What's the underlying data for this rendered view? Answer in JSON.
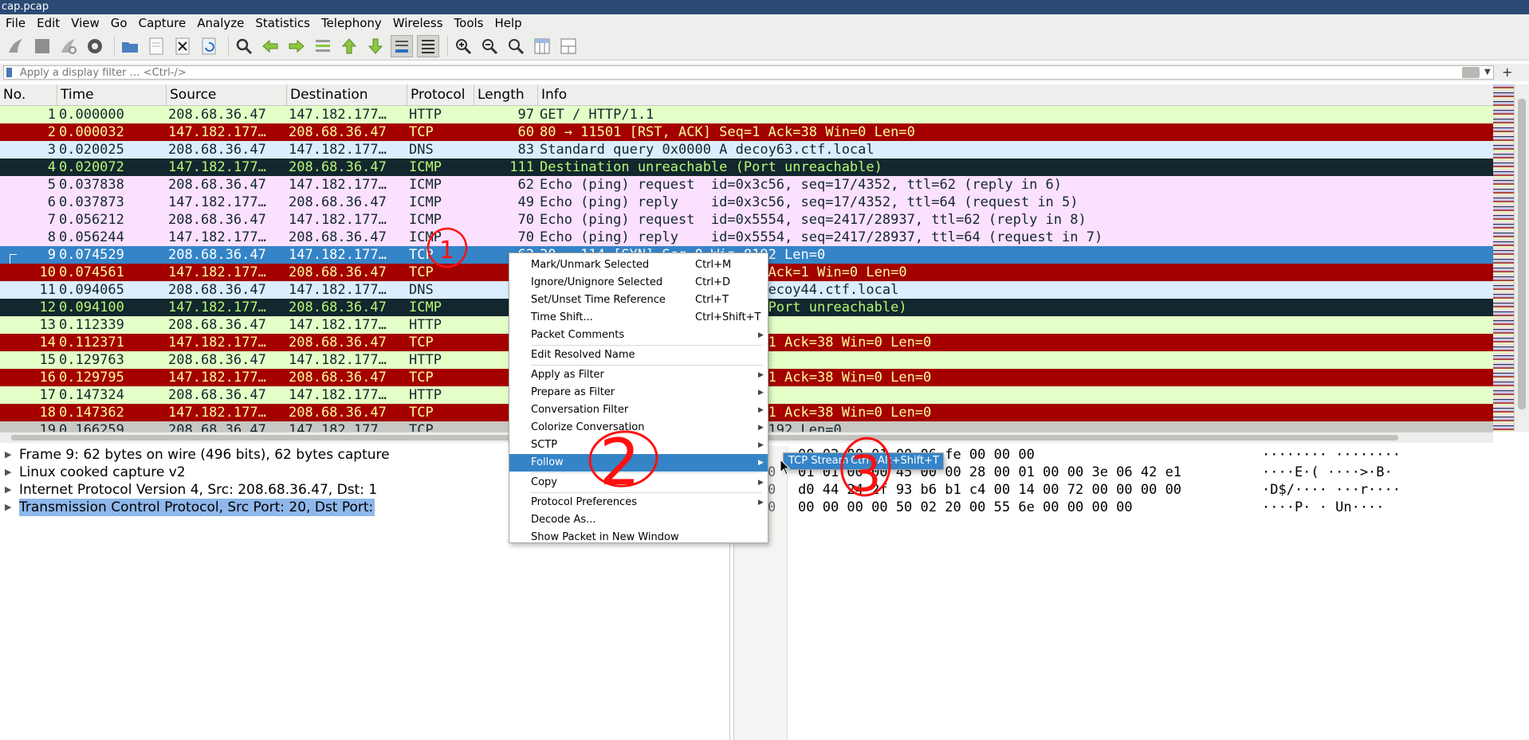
{
  "window": {
    "title": "cap.pcap"
  },
  "menubar": [
    "File",
    "Edit",
    "View",
    "Go",
    "Capture",
    "Analyze",
    "Statistics",
    "Telephony",
    "Wireless",
    "Tools",
    "Help"
  ],
  "toolbar": {
    "icons": [
      "shark-fin-start-icon",
      "stop-square-icon",
      "shark-fin-restart-icon",
      "capture-options-gear-icon",
      "open-folder-icon",
      "save-file-icon",
      "close-file-icon",
      "reload-icon",
      "find-magnifier-icon",
      "go-back-arrow-icon",
      "go-forward-arrow-icon",
      "go-to-packet-icon",
      "go-first-icon",
      "go-last-icon",
      "autoscroll-icon",
      "colorize-icon",
      "zoom-in-icon",
      "zoom-out-icon",
      "zoom-normal-icon",
      "resize-columns-icon",
      "layout-icon"
    ]
  },
  "filter": {
    "placeholder": "Apply a display filter … <Ctrl-/>"
  },
  "columns": [
    "No.",
    "Time",
    "Source",
    "Destination",
    "Protocol",
    "Length",
    "Info"
  ],
  "colors": {
    "http_bg": "#e4ffc7",
    "http_fg": "#12272e",
    "tcp_err_bg": "#a40000",
    "tcp_err_fg": "#fffc9c",
    "dns_bg": "#daeeff",
    "dns_fg": "#12272e",
    "icmp_err_bg": "#12272e",
    "icmp_err_fg": "#b7f774",
    "icmp_bg": "#fce0ff",
    "icmp_fg": "#12272e",
    "selected_bg": "#3584c7",
    "selected_fg": "#ffffff",
    "annotation_red": "#ff1010"
  },
  "packets": [
    {
      "no": "1",
      "time": "0.000000",
      "src": "208.68.36.47",
      "dst": "147.182.177…",
      "proto": "HTTP",
      "len": "97",
      "info": "GET / HTTP/1.1",
      "cls": "http"
    },
    {
      "no": "2",
      "time": "0.000032",
      "src": "147.182.177…",
      "dst": "208.68.36.47",
      "proto": "TCP",
      "len": "60",
      "info": "80 → 11501 [RST, ACK] Seq=1 Ack=38 Win=0 Len=0",
      "cls": "tcp_err"
    },
    {
      "no": "3",
      "time": "0.020025",
      "src": "208.68.36.47",
      "dst": "147.182.177…",
      "proto": "DNS",
      "len": "83",
      "info": "Standard query 0x0000 A decoy63.ctf.local",
      "cls": "dns"
    },
    {
      "no": "4",
      "time": "0.020072",
      "src": "147.182.177…",
      "dst": "208.68.36.47",
      "proto": "ICMP",
      "len": "111",
      "info": "Destination unreachable (Port unreachable)",
      "cls": "icmp_err"
    },
    {
      "no": "5",
      "time": "0.037838",
      "src": "208.68.36.47",
      "dst": "147.182.177…",
      "proto": "ICMP",
      "len": "62",
      "info": "Echo (ping) request  id=0x3c56, seq=17/4352, ttl=62 (reply in 6)",
      "cls": "icmp"
    },
    {
      "no": "6",
      "time": "0.037873",
      "src": "147.182.177…",
      "dst": "208.68.36.47",
      "proto": "ICMP",
      "len": "49",
      "info": "Echo (ping) reply    id=0x3c56, seq=17/4352, ttl=64 (request in 5)",
      "cls": "icmp"
    },
    {
      "no": "7",
      "time": "0.056212",
      "src": "208.68.36.47",
      "dst": "147.182.177…",
      "proto": "ICMP",
      "len": "70",
      "info": "Echo (ping) request  id=0x5554, seq=2417/28937, ttl=62 (reply in 8)",
      "cls": "icmp"
    },
    {
      "no": "8",
      "time": "0.056244",
      "src": "147.182.177…",
      "dst": "208.68.36.47",
      "proto": "ICMP",
      "len": "70",
      "info": "Echo (ping) reply    id=0x5554, seq=2417/28937, ttl=64 (request in 7)",
      "cls": "icmp"
    },
    {
      "no": "9",
      "time": "0.074529",
      "src": "208.68.36.47",
      "dst": "147.182.177…",
      "proto": "TCP",
      "len": "62",
      "info": "20 → 114 [SYN] Seq=0 Win=8192 Len=0",
      "cls": "selected"
    },
    {
      "no": "10",
      "time": "0.074561",
      "src": "147.182.177…",
      "dst": "208.68.36.47",
      "proto": "TCP",
      "len": "",
      "info": "                            Ack=1 Win=0 Len=0",
      "cls": "tcp_err"
    },
    {
      "no": "11",
      "time": "0.094065",
      "src": "208.68.36.47",
      "dst": "147.182.177…",
      "proto": "DNS",
      "len": "",
      "info": "                            ecoy44.ctf.local",
      "cls": "dns"
    },
    {
      "no": "12",
      "time": "0.094100",
      "src": "147.182.177…",
      "dst": "208.68.36.47",
      "proto": "ICMP",
      "len": "",
      "info": "                            Port unreachable)",
      "cls": "icmp_err"
    },
    {
      "no": "13",
      "time": "0.112339",
      "src": "208.68.36.47",
      "dst": "147.182.177…",
      "proto": "HTTP",
      "len": "",
      "info": "",
      "cls": "http"
    },
    {
      "no": "14",
      "time": "0.112371",
      "src": "147.182.177…",
      "dst": "208.68.36.47",
      "proto": "TCP",
      "len": "",
      "info": "                           =1 Ack=38 Win=0 Len=0",
      "cls": "tcp_err"
    },
    {
      "no": "15",
      "time": "0.129763",
      "src": "208.68.36.47",
      "dst": "147.182.177…",
      "proto": "HTTP",
      "len": "",
      "info": "",
      "cls": "http"
    },
    {
      "no": "16",
      "time": "0.129795",
      "src": "147.182.177…",
      "dst": "208.68.36.47",
      "proto": "TCP",
      "len": "",
      "info": "                           =1 Ack=38 Win=0 Len=0",
      "cls": "tcp_err"
    },
    {
      "no": "17",
      "time": "0.147324",
      "src": "208.68.36.47",
      "dst": "147.182.177…",
      "proto": "HTTP",
      "len": "",
      "info": "",
      "cls": "http"
    },
    {
      "no": "18",
      "time": "0.147362",
      "src": "147.182.177…",
      "dst": "208.68.36.47",
      "proto": "TCP",
      "len": "",
      "info": "                           =1 Ack=38 Win=0 Len=0",
      "cls": "tcp_err"
    },
    {
      "no": "19",
      "time": "0.166259",
      "src": "208.68.36.47",
      "dst": "147.182.177…",
      "proto": "TCP",
      "len": "",
      "info": "                           8192 Len=0",
      "cls": "partial"
    }
  ],
  "details": [
    {
      "label": "Frame 9: 62 bytes on wire (496 bits), 62 bytes capture",
      "selected": false
    },
    {
      "label": "Linux cooked capture v2",
      "selected": false
    },
    {
      "label": "Internet Protocol Version 4, Src: 208.68.36.47, Dst: 1",
      "selected": false
    },
    {
      "label": "Transmission Control Protocol, Src Port: 20, Dst Port:",
      "selected": true
    }
  ],
  "bytes": [
    {
      "off": "",
      "hex": "       00 02  00 01 00 06 fe 00 00 00",
      "ascii": "········ ········"
    },
    {
      "off": "0",
      "hex": "01 01 00 00 45 00 00 28  00 01 00 00 3e 06 42 e1",
      "ascii": "····E·(  ····>·B·"
    },
    {
      "off": "0",
      "hex": "d0 44 24 2f 93 b6 b1 c4  00 14 00 72 00 00 00 00",
      "ascii": "·D$/····  ···r····"
    },
    {
      "off": "0",
      "hex": "00 00 00 00 50 02 20 00  55 6e 00 00 00 00",
      "ascii": "····P· ·  Un····"
    }
  ],
  "context_menu": {
    "items": [
      {
        "label": "Mark/Unmark Selected",
        "shortcut": "Ctrl+M",
        "submenu": false
      },
      {
        "label": "Ignore/Unignore Selected",
        "shortcut": "Ctrl+D",
        "submenu": false
      },
      {
        "label": "Set/Unset Time Reference",
        "shortcut": "Ctrl+T",
        "submenu": false
      },
      {
        "label": "Time Shift...",
        "shortcut": "Ctrl+Shift+T",
        "submenu": false
      },
      {
        "label": "Packet Comments",
        "shortcut": "",
        "submenu": true
      },
      {
        "sep": true
      },
      {
        "label": "Edit Resolved Name",
        "shortcut": "",
        "submenu": false
      },
      {
        "sep": true
      },
      {
        "label": "Apply as Filter",
        "shortcut": "",
        "submenu": true
      },
      {
        "label": "Prepare as Filter",
        "shortcut": "",
        "submenu": true
      },
      {
        "label": "Conversation Filter",
        "shortcut": "",
        "submenu": true
      },
      {
        "label": "Colorize Conversation",
        "shortcut": "",
        "submenu": true
      },
      {
        "label": "SCTP",
        "shortcut": "",
        "submenu": true
      },
      {
        "label": "Follow",
        "shortcut": "",
        "submenu": true,
        "active": true
      },
      {
        "sep": true
      },
      {
        "label": "Copy",
        "shortcut": "",
        "submenu": true
      },
      {
        "sep": true
      },
      {
        "label": "Protocol Preferences",
        "shortcut": "",
        "submenu": true
      },
      {
        "label": "Decode As...",
        "shortcut": "",
        "submenu": false
      },
      {
        "label": "Show Packet in New Window",
        "shortcut": "",
        "submenu": false
      }
    ]
  },
  "submenu": {
    "label": "TCP Stream",
    "shortcut": "Ctrl+Alt+Shift+T"
  },
  "annotations": {
    "one": "1",
    "two": "2",
    "three": "3"
  }
}
